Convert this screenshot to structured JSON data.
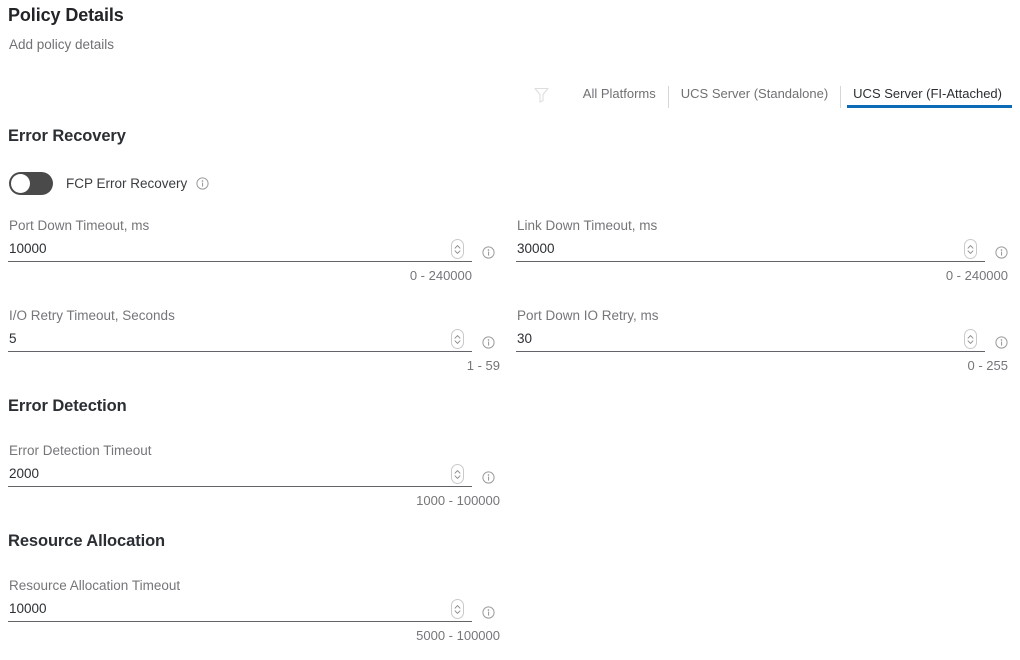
{
  "header": {
    "title": "Policy Details",
    "subtitle": "Add policy details"
  },
  "platform_filter": {
    "filter_icon": "filter-funnel-icon",
    "tabs": [
      {
        "label": "All Platforms",
        "active": false
      },
      {
        "label": "UCS Server (Standalone)",
        "active": false
      },
      {
        "label": "UCS Server (FI-Attached)",
        "active": true
      }
    ],
    "active_underline_color": "#0d6ab5"
  },
  "sections": [
    {
      "title": "Error Recovery",
      "toggle": {
        "label": "FCP Error Recovery",
        "state": "off",
        "track_color": "#4a4a4a",
        "knob_color": "#ffffff",
        "info_icon": "info-circle-icon"
      },
      "fields": [
        {
          "label": "Port Down Timeout, ms",
          "value": "10000",
          "range": "0 - 240000",
          "spinner_icon": "stepper-up-down-icon",
          "info_icon": "info-circle-icon"
        },
        {
          "label": "Link Down Timeout, ms",
          "value": "30000",
          "range": "0 - 240000",
          "spinner_icon": "stepper-up-down-icon",
          "info_icon": "info-circle-icon"
        },
        {
          "label": "I/O Retry Timeout, Seconds",
          "value": "5",
          "range": "1 - 59",
          "spinner_icon": "stepper-up-down-icon",
          "info_icon": "info-circle-icon"
        },
        {
          "label": "Port Down IO Retry, ms",
          "value": "30",
          "range": "0 - 255",
          "spinner_icon": "stepper-up-down-icon",
          "info_icon": "info-circle-icon"
        }
      ]
    },
    {
      "title": "Error Detection",
      "fields": [
        {
          "label": "Error Detection Timeout",
          "value": "2000",
          "range": "1000 - 100000",
          "spinner_icon": "stepper-up-down-icon",
          "info_icon": "info-circle-icon"
        }
      ]
    },
    {
      "title": "Resource Allocation",
      "fields": [
        {
          "label": "Resource Allocation Timeout",
          "value": "10000",
          "range": "5000 - 100000",
          "spinner_icon": "stepper-up-down-icon",
          "info_icon": "info-circle-icon"
        }
      ]
    }
  ]
}
